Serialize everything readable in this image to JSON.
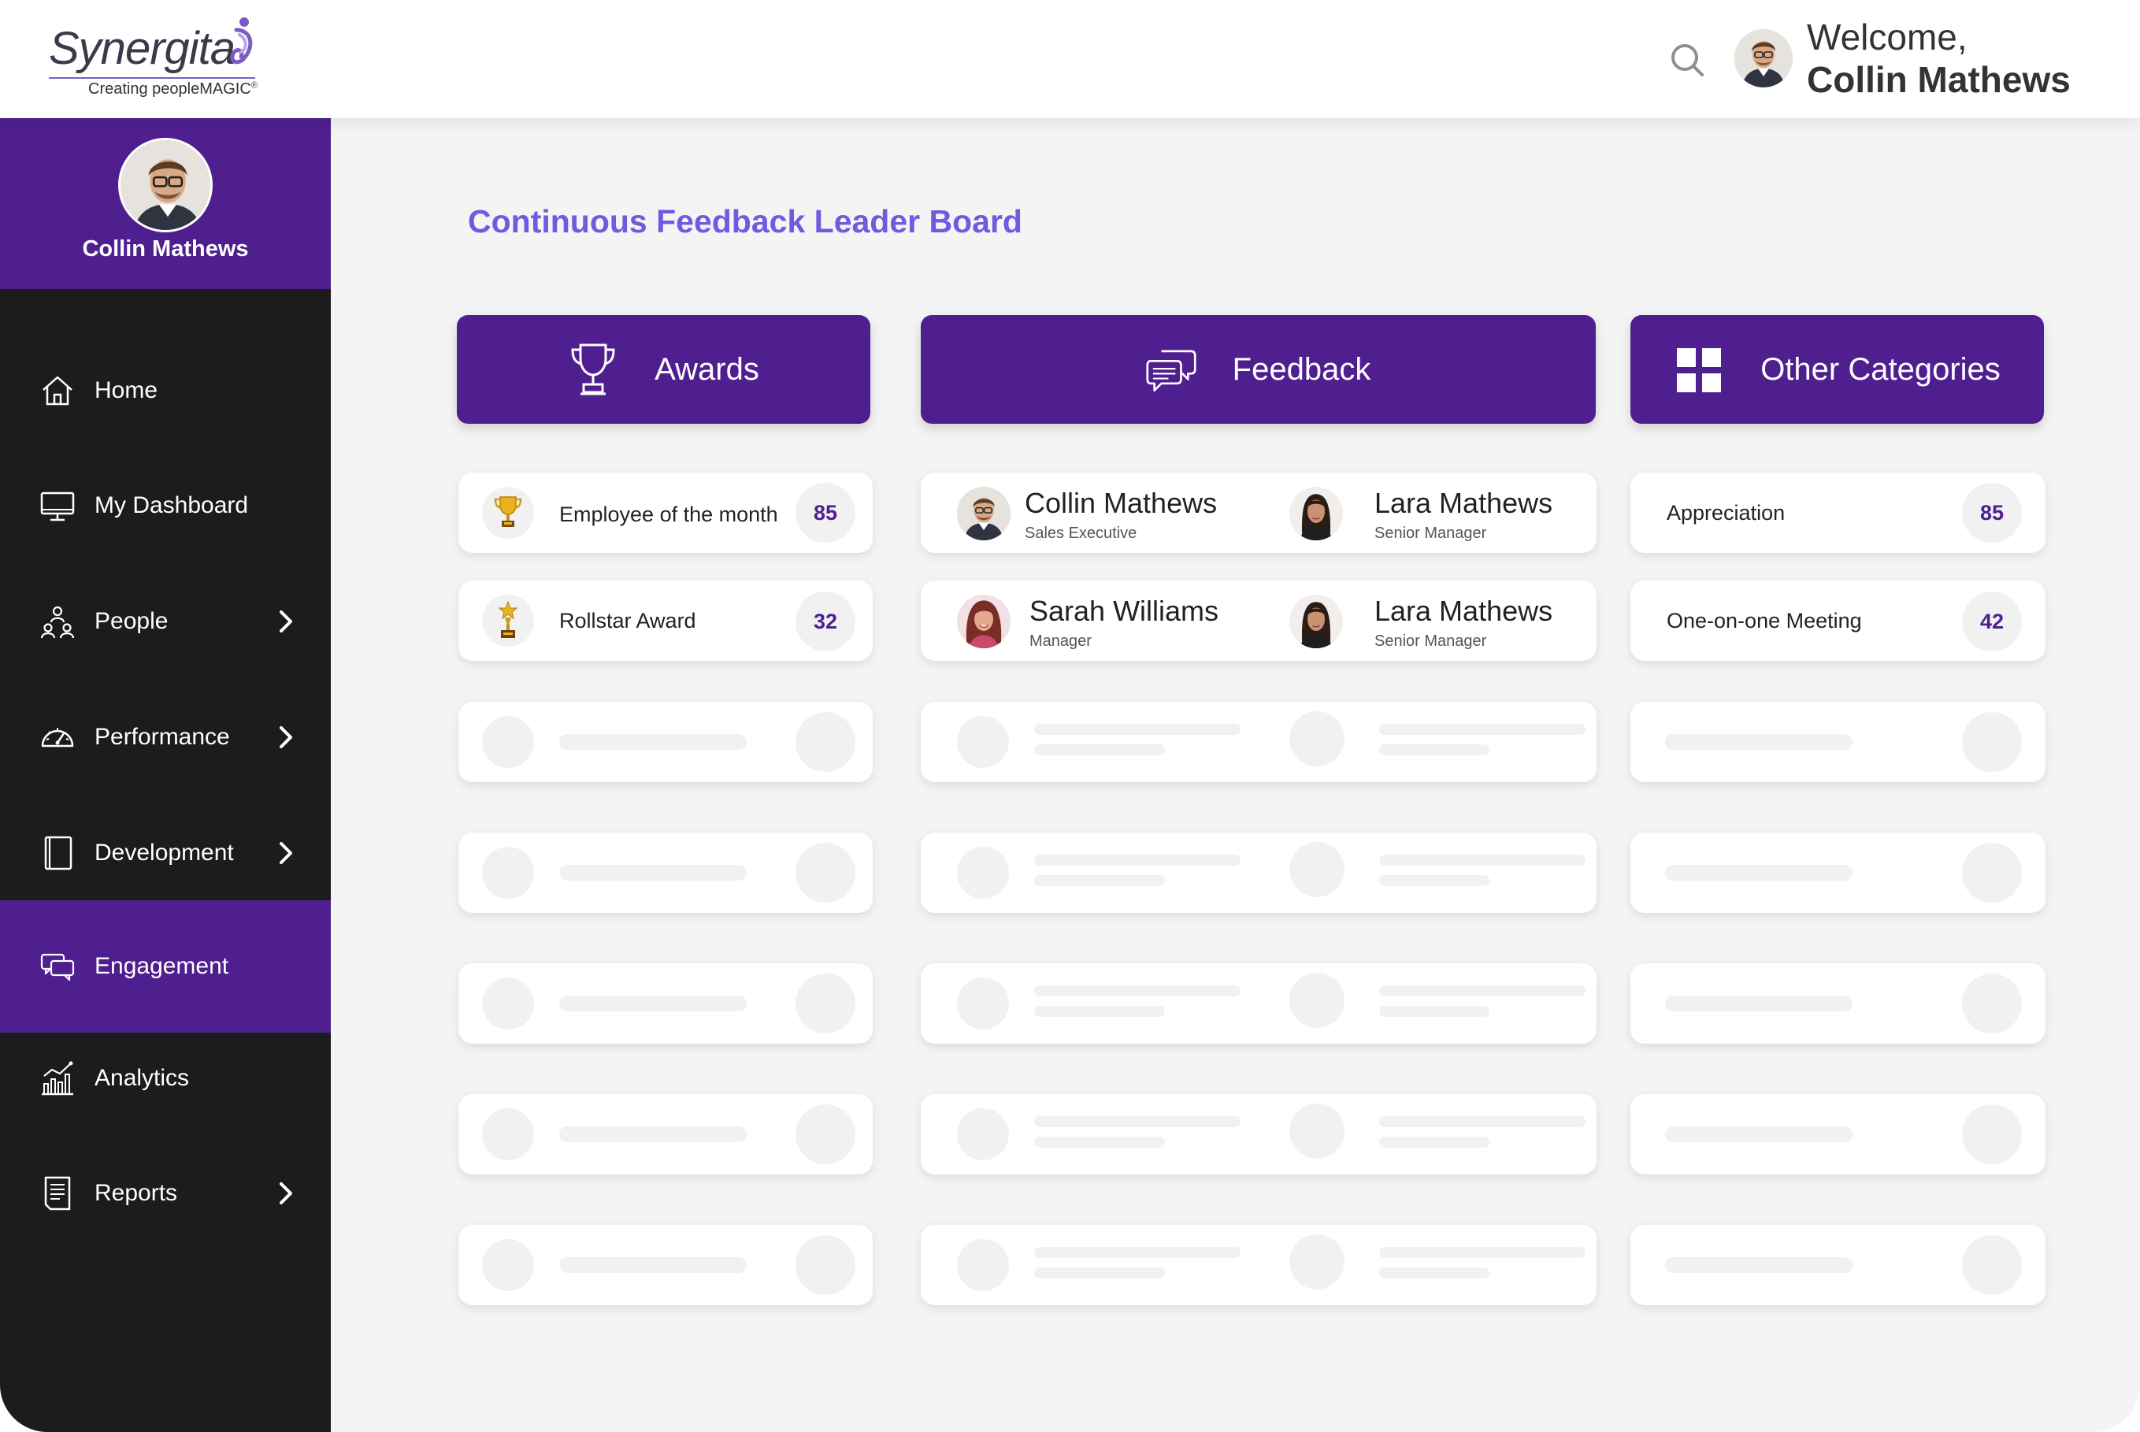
{
  "brand": {
    "name": "Synergita",
    "tagline": "Creating peopleMAGIC",
    "tagline_mark": "®"
  },
  "header": {
    "welcome": "Welcome,",
    "user_name": "Collin Mathews"
  },
  "sidebar": {
    "profile_name": "Collin Mathews",
    "items": [
      {
        "label": "Home",
        "icon": "home-icon",
        "has_submenu": false,
        "active": false
      },
      {
        "label": "My Dashboard",
        "icon": "monitor-icon",
        "has_submenu": false,
        "active": false
      },
      {
        "label": "People",
        "icon": "people-icon",
        "has_submenu": true,
        "active": false
      },
      {
        "label": "Performance",
        "icon": "speedometer-icon",
        "has_submenu": true,
        "active": false
      },
      {
        "label": "Development",
        "icon": "book-icon",
        "has_submenu": true,
        "active": false
      },
      {
        "label": "Engagement",
        "icon": "chat-icon",
        "has_submenu": false,
        "active": true
      },
      {
        "label": "Analytics",
        "icon": "analytics-icon",
        "has_submenu": false,
        "active": false
      },
      {
        "label": "Reports",
        "icon": "report-icon",
        "has_submenu": true,
        "active": false
      }
    ]
  },
  "main": {
    "title": "Continuous Feedback Leader Board",
    "columns": {
      "awards": {
        "label": "Awards",
        "icon": "trophy-icon",
        "rows": [
          {
            "name": "Employee of the month",
            "count": "85",
            "icon": "gold-trophy-icon"
          },
          {
            "name": "Rollstar Award",
            "count": "32",
            "icon": "star-trophy-icon"
          }
        ]
      },
      "feedback": {
        "label": "Feedback",
        "icon": "speech-bubbles-icon",
        "rows": [
          {
            "from": {
              "name": "Collin Mathews",
              "role": "Sales Executive"
            },
            "to": {
              "name": "Lara Mathews",
              "role": "Senior Manager"
            }
          },
          {
            "from": {
              "name": "Sarah Williams",
              "role": "Manager"
            },
            "to": {
              "name": "Lara Mathews",
              "role": "Senior Manager"
            }
          }
        ]
      },
      "other": {
        "label": "Other Categories",
        "icon": "grid-icon",
        "rows": [
          {
            "name": "Appreciation",
            "count": "85"
          },
          {
            "name": "One-on-one Meeting",
            "count": "42"
          }
        ]
      }
    }
  },
  "colors": {
    "brand_purple": "#4f1f8f",
    "title_violet": "#6d5be0",
    "sidebar_dark": "#1c1c1c",
    "skeleton": "#f1f1f1"
  }
}
